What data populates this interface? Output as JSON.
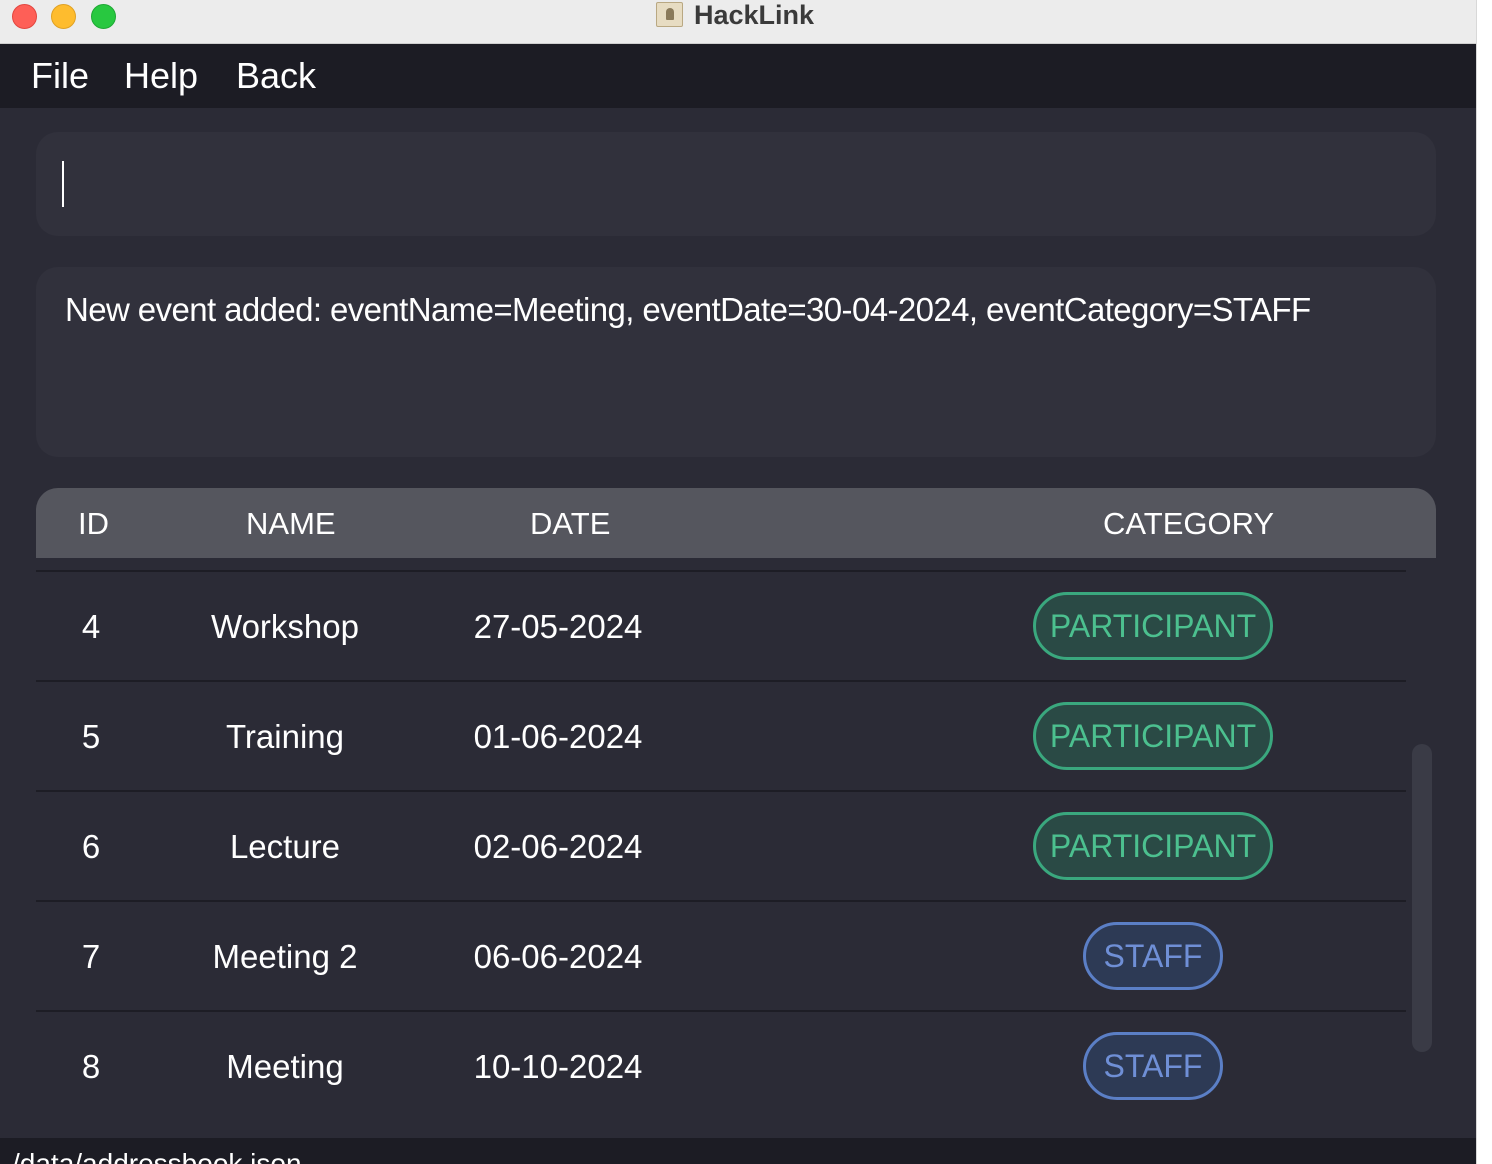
{
  "window": {
    "title": "HackLink"
  },
  "menu": {
    "file": "File",
    "help": "Help",
    "back": "Back"
  },
  "command": {
    "value": ""
  },
  "result": {
    "text": "New event added: eventName=Meeting, eventDate=30-04-2024, eventCategory=STAFF"
  },
  "table": {
    "headers": {
      "id": "ID",
      "name": "NAME",
      "date": "DATE",
      "category": "CATEGORY"
    },
    "rows": [
      {
        "id": "4",
        "name": "Workshop",
        "date": "27-05-2024",
        "category": "PARTICIPANT"
      },
      {
        "id": "5",
        "name": "Training",
        "date": "01-06-2024",
        "category": "PARTICIPANT"
      },
      {
        "id": "6",
        "name": "Lecture",
        "date": "02-06-2024",
        "category": "PARTICIPANT"
      },
      {
        "id": "7",
        "name": "Meeting 2",
        "date": "06-06-2024",
        "category": "STAFF"
      },
      {
        "id": "8",
        "name": "Meeting",
        "date": "10-10-2024",
        "category": "STAFF"
      }
    ]
  },
  "status": {
    "path": "/data/addressbook.json"
  },
  "colors": {
    "participant": "#4cc08f",
    "staff": "#6f8fd6",
    "background": "#2b2b36",
    "menubar": "#1c1c24"
  },
  "icons": {
    "close": "close-icon",
    "minimize": "minimize-icon",
    "maximize": "maximize-icon",
    "app": "app-icon"
  }
}
